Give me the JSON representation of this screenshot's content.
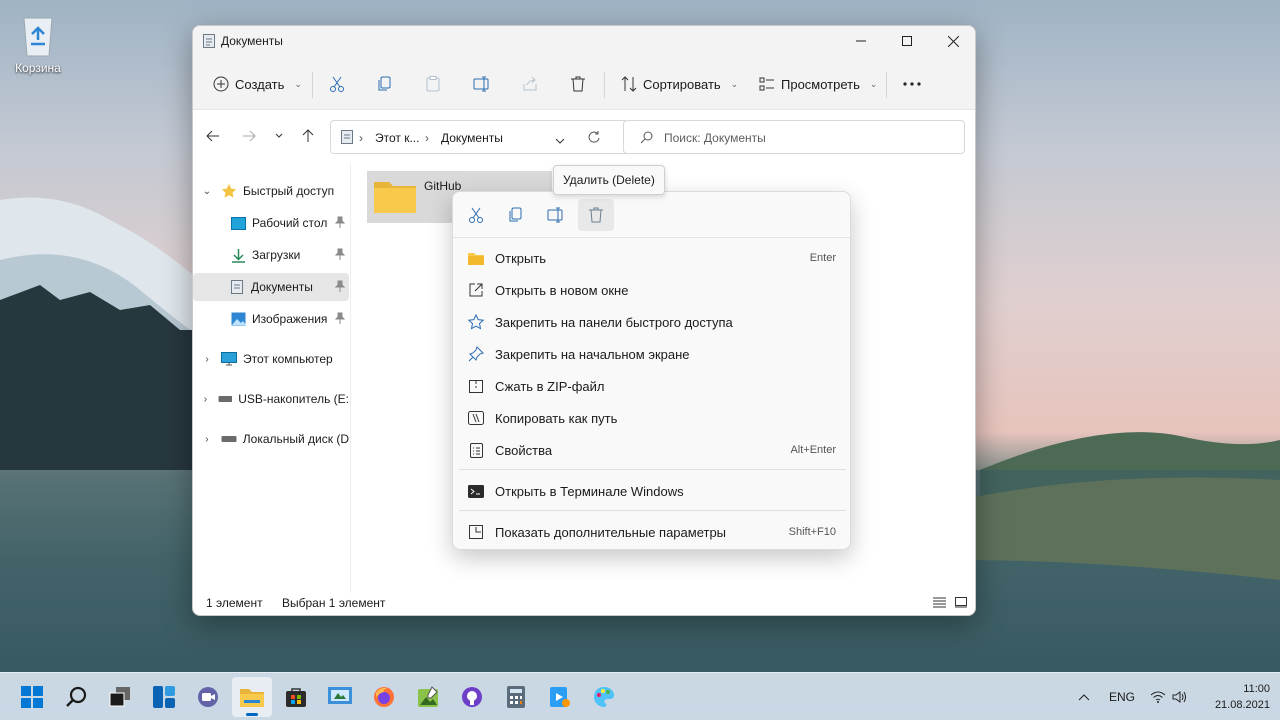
{
  "desktop": {
    "recycle_bin_label": "Корзина"
  },
  "window": {
    "title": "Документы",
    "commands": {
      "create": "Создать",
      "sort": "Сортировать",
      "view": "Просмотреть"
    },
    "address": {
      "seg1": "Этот к...",
      "seg2": "Документы"
    },
    "search_placeholder": "Поиск: Документы",
    "sidebar": {
      "quick_access": "Быстрый доступ",
      "desktop": "Рабочий стол",
      "downloads": "Загрузки",
      "documents": "Документы",
      "images": "Изображения",
      "this_pc": "Этот компьютер",
      "usb": "USB-накопитель (E:",
      "local_disk": "Локальный диск (D"
    },
    "folder_name": "GitHub",
    "status": {
      "count": "1 элемент",
      "selected": "Выбран 1 элемент"
    }
  },
  "tooltip": "Удалить (Delete)",
  "context_menu": {
    "items": [
      {
        "label": "Открыть",
        "key": "Enter"
      },
      {
        "label": "Открыть в новом окне",
        "key": ""
      },
      {
        "label": "Закрепить на панели быстрого доступа",
        "key": ""
      },
      {
        "label": "Закрепить на начальном экране",
        "key": ""
      },
      {
        "label": "Сжать в ZIP-файл",
        "key": ""
      },
      {
        "label": "Копировать как путь",
        "key": ""
      },
      {
        "label": "Свойства",
        "key": "Alt+Enter"
      },
      {
        "label": "Открыть в Терминале Windows",
        "key": ""
      },
      {
        "label": "Показать дополнительные параметры",
        "key": "Shift+F10"
      }
    ]
  },
  "taskbar": {
    "language": "ENG",
    "time": "11:00",
    "date": "21.08.2021"
  },
  "colors": {
    "accent": "#0067c0",
    "folder": "#f8c94a",
    "icon_blue": "#2b6cb0"
  }
}
